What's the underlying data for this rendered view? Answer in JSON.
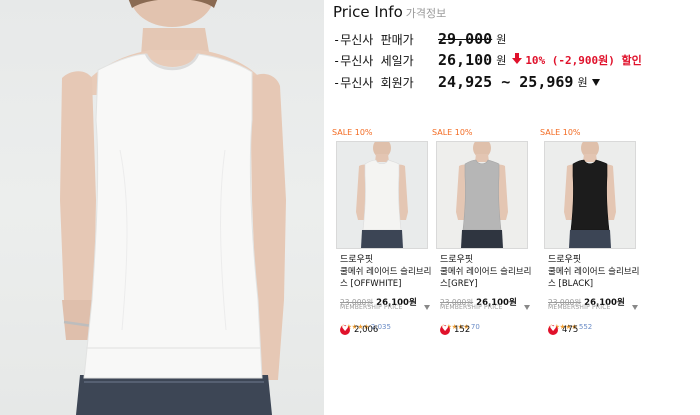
{
  "price_info": {
    "title": "Price Info",
    "subtitle": "가격정보",
    "rows": [
      {
        "label": "-무신사 판매가",
        "value": "29,000",
        "unit": "원"
      },
      {
        "label": "-무신사 세일가",
        "value": "26,100",
        "unit": "원",
        "discount": "10% (-2,900원) 할인"
      },
      {
        "label": "-무신사 회원가",
        "value": "24,925 ~ 25,969",
        "unit": "원"
      }
    ]
  },
  "products": [
    {
      "badge": "SALE 10%",
      "brand": "드로우핏",
      "name": "쿨메쉬 레이어드 슬리브리스 [OFFWHITE]",
      "original_price": "23,000원",
      "sale_price": "26,100원",
      "membership_label": "MEMBERSHIP PRICE",
      "stars": "★★★★★",
      "rating_count": "2,035",
      "likes": "2,006",
      "shirt_color": "#f4f4f2"
    },
    {
      "badge": "SALE 10%",
      "brand": "드로우핏",
      "name": "쿨메쉬 레이어드 슬리브리스[GREY]",
      "original_price": "23,000원",
      "sale_price": "26,100원",
      "membership_label": "MEMBERSHIP PRICE",
      "stars": "★★★★★",
      "rating_count": "70",
      "likes": "152",
      "shirt_color": "#b6b6b6"
    },
    {
      "badge": "SALE 10%",
      "brand": "드로우핏",
      "name": "쿨메쉬 레이어드 슬리브리스 [BLACK]",
      "original_price": "23,000원",
      "sale_price": "26,100원",
      "membership_label": "MEMBERSHIP PRICE",
      "stars": "★★★★★",
      "rating_count": "552",
      "likes": "475",
      "shirt_color": "#1c1c1c"
    }
  ],
  "colors": {
    "sale_red": "#e0112b",
    "badge_orange": "#f36b22",
    "star_orange": "#f3a33a"
  }
}
